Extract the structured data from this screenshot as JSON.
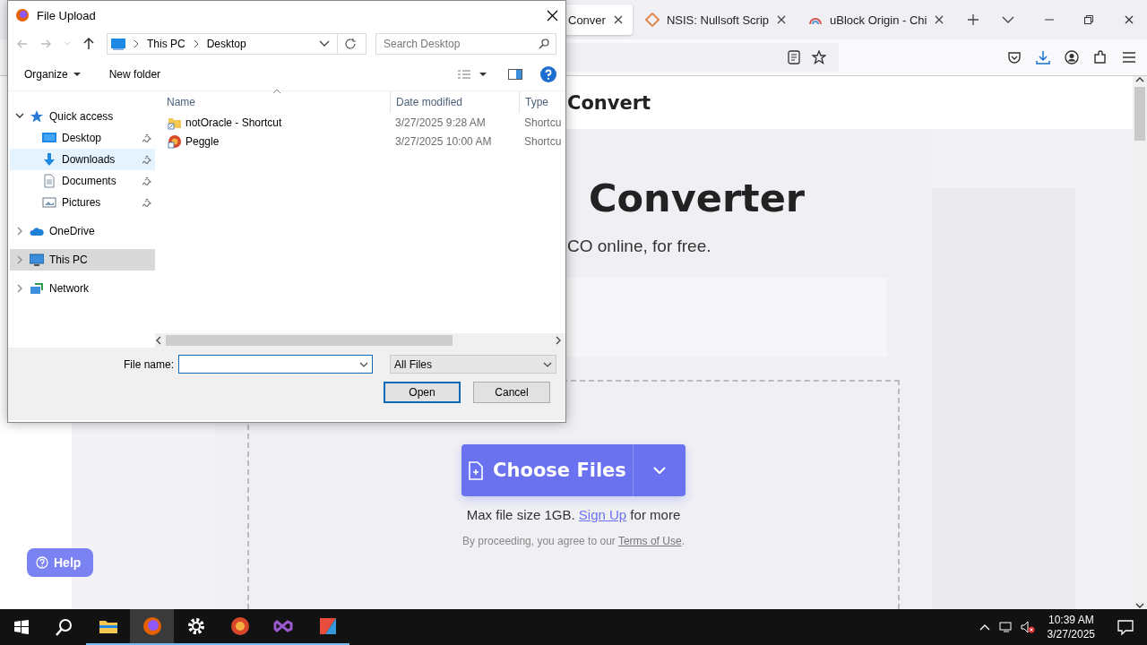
{
  "browser": {
    "tabs": [
      {
        "label": "Conver",
        "selected": true,
        "kind": "page"
      },
      {
        "label": "NSIS: Nullsoft Scrip",
        "selected": false,
        "kind": "nsis"
      },
      {
        "label": "uBlock Origin - Chi",
        "selected": false,
        "kind": "ublock"
      }
    ]
  },
  "page": {
    "header_title": "Convert",
    "heading": "Converter",
    "subtitle": "CO online, for free.",
    "upload_button": "Choose Files",
    "limit_text": "Max file size 1GB.",
    "limit_link": "Sign Up",
    "limit_suffix": "for more",
    "terms_text": "By proceeding, you agree to our",
    "terms_link": "Terms of Use",
    "terms_end": ".",
    "help_button": "Help"
  },
  "dialog": {
    "title": "File Upload",
    "breadcrumb": [
      "This PC",
      "Desktop"
    ],
    "search": {
      "placeholder": "Search Desktop"
    },
    "toolbar": [
      "Organize",
      "New folder"
    ],
    "nav": [
      {
        "label": "Quick access",
        "kind": "star",
        "expanded": true,
        "selected": false,
        "hovered": false,
        "children": [
          {
            "label": "Desktop",
            "kind": "desktop",
            "pinned": true,
            "selected": false,
            "hovered": false
          },
          {
            "label": "Downloads",
            "kind": "download",
            "pinned": true,
            "selected": false,
            "hovered": true
          },
          {
            "label": "Documents",
            "kind": "document",
            "pinned": true,
            "selected": false,
            "hovered": false
          },
          {
            "label": "Pictures",
            "kind": "pictures",
            "pinned": true,
            "selected": false,
            "hovered": false
          }
        ]
      },
      {
        "label": "OneDrive",
        "kind": "cloud",
        "expanded": false,
        "selected": false,
        "hovered": false
      },
      {
        "label": "This PC",
        "kind": "pc",
        "expanded": false,
        "selected": true,
        "hovered": false
      },
      {
        "label": "Network",
        "kind": "network",
        "expanded": false,
        "selected": false,
        "hovered": false
      }
    ],
    "columns": [
      "Name",
      "Date modified",
      "Type"
    ],
    "files": [
      {
        "name": "notOracle - Shortcut",
        "date": "3/27/2025 9:28 AM",
        "type": "Shortcu",
        "kind": "folder-shortcut"
      },
      {
        "name": "Peggle",
        "date": "3/27/2025 10:00 AM",
        "type": "Shortcu",
        "kind": "app"
      }
    ],
    "file_name_label": "File name:",
    "file_type": "All Files",
    "buttons": [
      "Open",
      "Cancel"
    ]
  },
  "taskbar": {
    "apps": [
      {
        "kind": "files",
        "active": false
      },
      {
        "kind": "browser",
        "active": true
      },
      {
        "kind": "settings",
        "active": false
      },
      {
        "kind": "ball",
        "active": false
      },
      {
        "kind": "studio",
        "active": false
      },
      {
        "kind": "editor",
        "active": false
      }
    ],
    "time": "10:39 AM",
    "date": "3/27/2025"
  }
}
